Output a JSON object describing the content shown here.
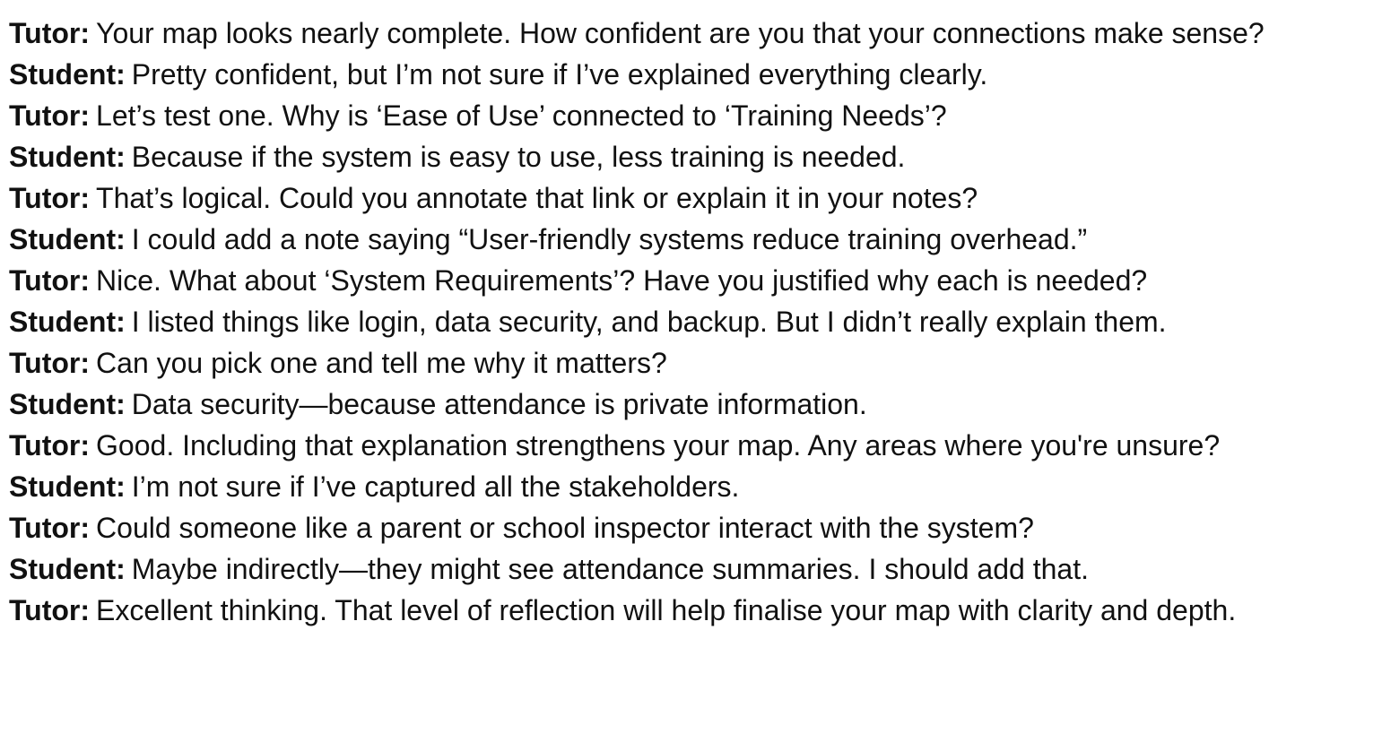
{
  "dialogue": [
    {
      "speaker": "Tutor:",
      "text": "Your map looks nearly complete. How confident are you that your connections make sense?"
    },
    {
      "speaker": "Student:",
      "text": "Pretty confident, but I’m not sure if I’ve explained everything clearly."
    },
    {
      "speaker": "Tutor:",
      "text": "Let’s test one. Why is ‘Ease of Use’ connected to ‘Training Needs’?"
    },
    {
      "speaker": "Student:",
      "text": "Because if the system is easy to use, less training is needed."
    },
    {
      "speaker": "Tutor:",
      "text": "That’s logical. Could you annotate that link or explain it in your notes?"
    },
    {
      "speaker": "Student:",
      "text": "I could add a note saying “User-friendly systems reduce training overhead.”"
    },
    {
      "speaker": "Tutor:",
      "text": "Nice. What about ‘System Requirements’? Have you justified why each is needed?"
    },
    {
      "speaker": "Student:",
      "text": "I listed things like login, data security, and backup. But I didn’t really explain them."
    },
    {
      "speaker": "Tutor:",
      "text": "Can you pick one and tell me why it matters?"
    },
    {
      "speaker": "Student:",
      "text": "Data security—because attendance is private information."
    },
    {
      "speaker": "Tutor:",
      "text": "Good. Including that explanation strengthens your map. Any areas where you're unsure?"
    },
    {
      "speaker": "Student:",
      "text": "I’m not sure if I’ve captured all the stakeholders."
    },
    {
      "speaker": "Tutor:",
      "text": "Could someone like a parent or school inspector interact with the system?"
    },
    {
      "speaker": "Student:",
      "text": "Maybe indirectly—they might see attendance summaries. I should add that."
    },
    {
      "speaker": "Tutor:",
      "text": "Excellent thinking. That level of reflection will help finalise your map with clarity and depth."
    }
  ]
}
